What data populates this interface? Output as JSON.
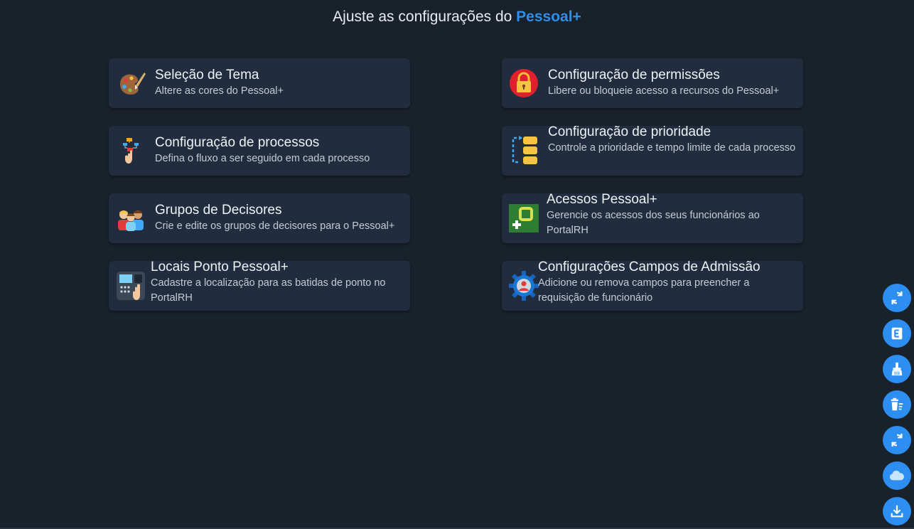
{
  "header": {
    "prefix": "Ajuste as configurações do",
    "brand": "Pessoal+"
  },
  "cards": [
    {
      "title": "Seleção de Tema",
      "desc": "Altere as cores do Pessoal+",
      "icon": "palette-icon"
    },
    {
      "title": "Configuração de permissões",
      "desc": "Libere ou bloqueie acesso a recursos do Pessoal+",
      "icon": "padlock-icon"
    },
    {
      "title": "Configuração de processos",
      "desc": "Defina o fluxo a ser seguido em cada processo",
      "icon": "process-flow-icon"
    },
    {
      "title": "Configuração de prioridade",
      "desc": "Controle a prioridade e tempo limite de cada processo",
      "icon": "priority-stack-icon"
    },
    {
      "title": "Grupos de Decisores",
      "desc": "Crie e edite os grupos de decisores para o Pessoal+",
      "icon": "people-group-icon"
    },
    {
      "title": "Acessos Pessoal+",
      "desc": "Gerencie os acessos dos seus funcionários ao PortalRH",
      "icon": "access-key-icon"
    },
    {
      "title": "Locais Ponto Pessoal+",
      "desc": "Cadastre a localização para as batidas de ponto no PortalRH",
      "icon": "time-clock-icon"
    },
    {
      "title": "Configurações Campos de Admissão",
      "desc": "Adicione ou remova campos para preencher a requisição de funcionário",
      "icon": "admission-gear-icon"
    }
  ],
  "fabs": [
    "refresh-icon",
    "letter-e-icon",
    "broom-icon",
    "trash-list-icon",
    "sync-icon",
    "cloud-icon",
    "download-icon"
  ],
  "colors": {
    "background": "#19212b",
    "card": "#212d3e",
    "accent": "#2c8ef0",
    "brand": "#2f8fe8"
  }
}
